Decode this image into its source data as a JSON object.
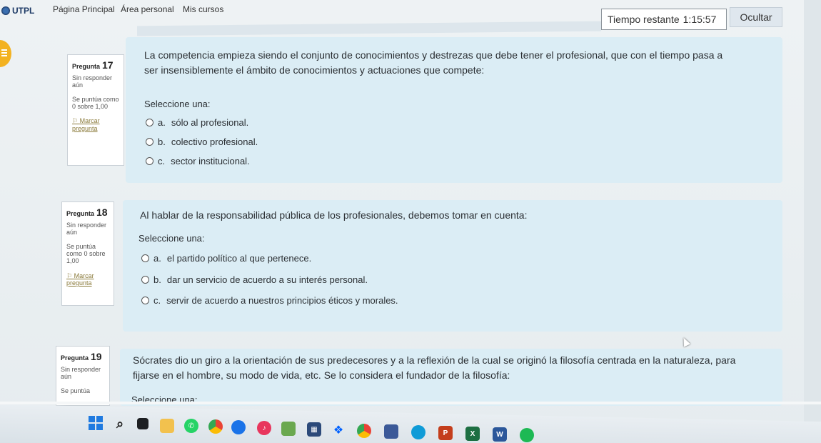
{
  "nav": {
    "logo_text": "UTPL",
    "links": [
      "Página Principal",
      "Área personal",
      "Mis cursos"
    ]
  },
  "timer": {
    "label": "Tiempo restante",
    "value": "1:15:57",
    "hide_label": "Ocultar"
  },
  "questions": [
    {
      "label": "Pregunta",
      "number": "17",
      "state": "Sin responder aún",
      "grade": "Se puntúa como 0 sobre 1,00",
      "flag": "Marcar pregunta",
      "text": "La competencia empieza siendo el conjunto de conocimientos y destrezas que debe tener el profesional, que con el tiempo pasa a ser insensiblemente el ámbito de conocimientos y actuaciones que compete:",
      "prompt": "Seleccione una:",
      "options": [
        {
          "letter": "a.",
          "text": "sólo al profesional."
        },
        {
          "letter": "b.",
          "text": "colectivo profesional."
        },
        {
          "letter": "c.",
          "text": "sector institucional."
        }
      ]
    },
    {
      "label": "Pregunta",
      "number": "18",
      "state": "Sin responder aún",
      "grade": "Se puntúa como 0 sobre 1,00",
      "flag": "Marcar pregunta",
      "text": "Al hablar de la responsabilidad pública de los profesionales, debemos tomar en cuenta:",
      "prompt": "Seleccione una:",
      "options": [
        {
          "letter": "a.",
          "text": "el partido político al que pertenece."
        },
        {
          "letter": "b.",
          "text": "dar un servicio de acuerdo a su interés personal."
        },
        {
          "letter": "c.",
          "text": "servir de acuerdo a nuestros principios éticos y morales."
        }
      ]
    },
    {
      "label": "Pregunta",
      "number": "19",
      "state": "Sin responder aún",
      "grade": "Se puntúa",
      "flag": "",
      "text": "Sócrates dio un giro a la orientación de sus predecesores y a la reflexión de la cual se originó la filosofía centrada en la naturaleza, para fijarse en el hombre, su modo de vida, etc. Se lo considera el fundador de la filosofía:",
      "prompt": "Seleccione una:",
      "options": []
    }
  ],
  "taskbar": {
    "icons": [
      "windows-start",
      "search",
      "task-view",
      "file-explorer",
      "whatsapp",
      "chrome-color",
      "edge",
      "music",
      "minecraft",
      "calculator",
      "dropbox",
      "chrome",
      "photos",
      "edge-blue",
      "powerpoint",
      "excel",
      "word",
      "spotify"
    ]
  },
  "colors": {
    "card_bg": "#dbedf5",
    "page_bg": "#eef2f4",
    "accent_badge": "#f3b221"
  }
}
